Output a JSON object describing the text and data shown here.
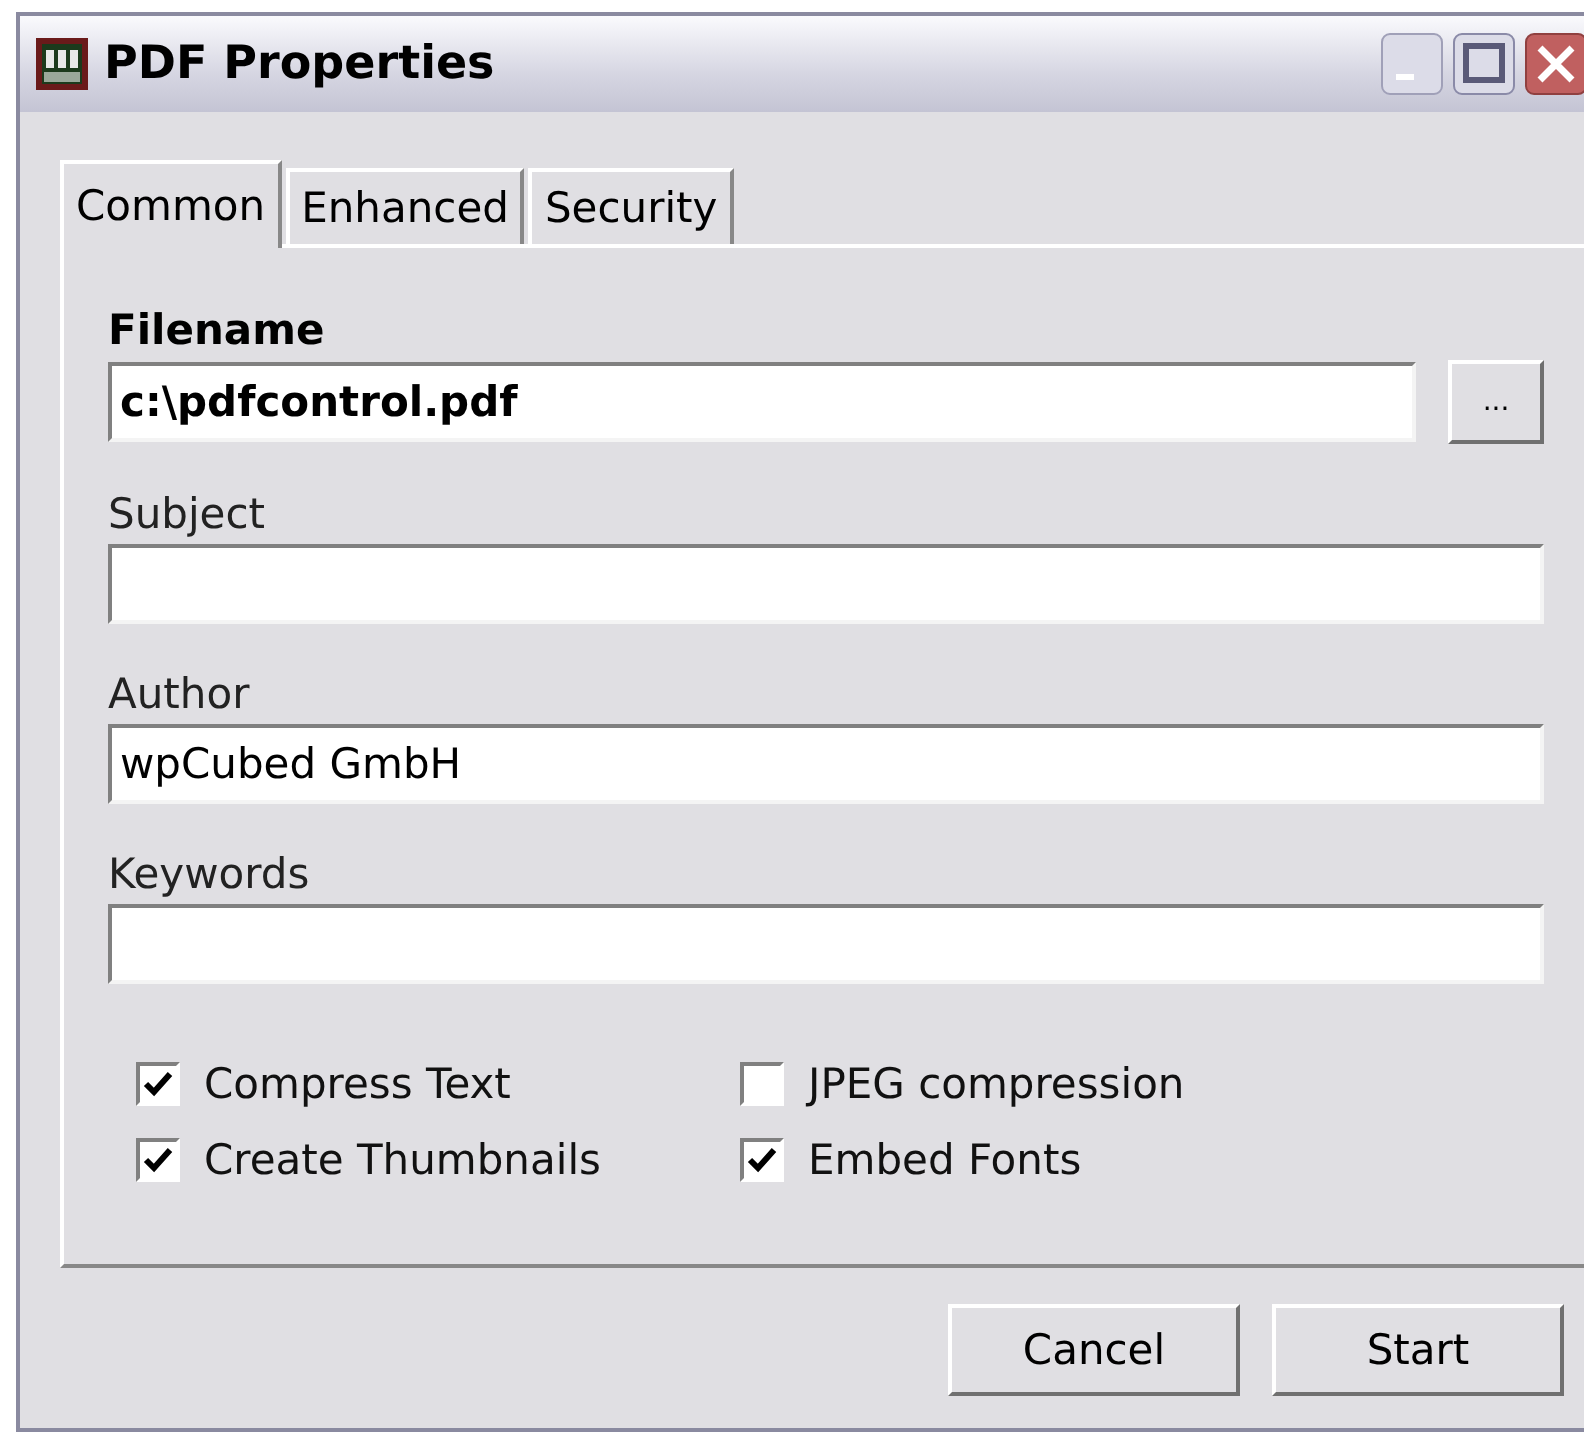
{
  "window": {
    "title": "PDF Properties"
  },
  "tabs": [
    {
      "label": "Common",
      "selected": true
    },
    {
      "label": "Enhanced",
      "selected": false
    },
    {
      "label": "Security",
      "selected": false
    }
  ],
  "fields": [
    {
      "kind": "browse",
      "label": "Filename",
      "value": "c:\\pdfcontrol.pdf",
      "button": "..."
    },
    {
      "kind": "plain",
      "label": "Subject"
    },
    {
      "kind": "plain",
      "label": "Author",
      "value": "wpCubed GmbH"
    },
    {
      "kind": "plain",
      "label": "Keywords"
    }
  ],
  "options": [
    {
      "label": "Compress Text",
      "checked": true
    },
    {
      "label": "JPEG compression",
      "checked": false
    },
    {
      "label": "Create Thumbnails",
      "checked": true
    },
    {
      "label": "Embed Fonts",
      "checked": true
    }
  ],
  "buttons": [
    "Cancel",
    "Start"
  ]
}
